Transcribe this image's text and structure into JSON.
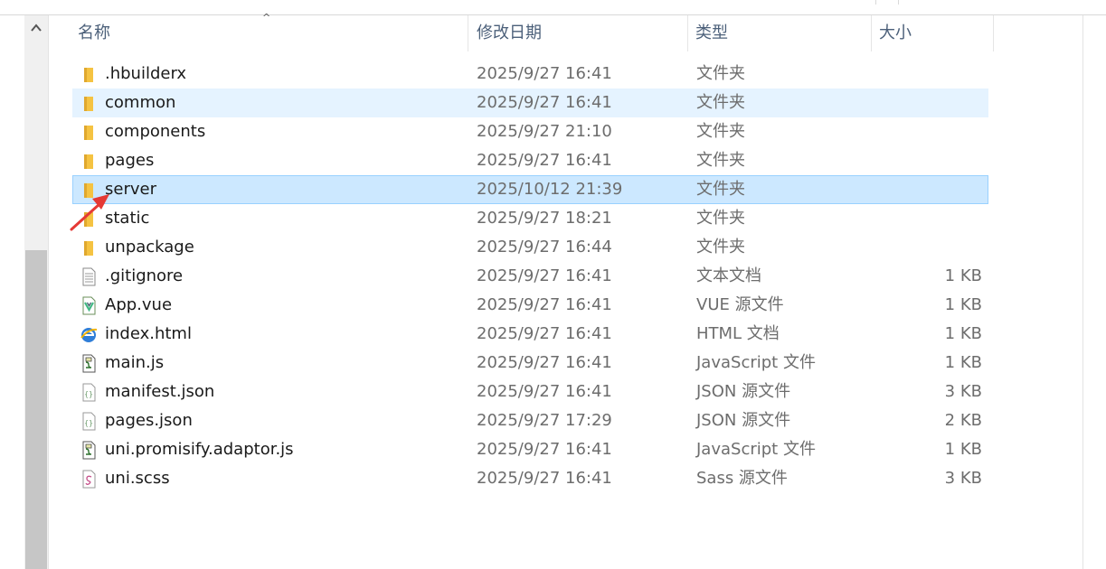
{
  "columns": {
    "name": "名称",
    "date": "修改日期",
    "type": "类型",
    "size": "大小"
  },
  "files": [
    {
      "name": ".hbuilderx",
      "date": "2025/9/27 16:41",
      "type": "文件夹",
      "size": "",
      "icon": "folder-icon",
      "state": "normal"
    },
    {
      "name": "common",
      "date": "2025/9/27 16:41",
      "type": "文件夹",
      "size": "",
      "icon": "folder-icon",
      "state": "hover"
    },
    {
      "name": "components",
      "date": "2025/9/27 21:10",
      "type": "文件夹",
      "size": "",
      "icon": "folder-icon",
      "state": "normal"
    },
    {
      "name": "pages",
      "date": "2025/9/27 16:41",
      "type": "文件夹",
      "size": "",
      "icon": "folder-icon",
      "state": "normal"
    },
    {
      "name": "server",
      "date": "2025/10/12 21:39",
      "type": "文件夹",
      "size": "",
      "icon": "folder-icon",
      "state": "selected"
    },
    {
      "name": "static",
      "date": "2025/9/27 18:21",
      "type": "文件夹",
      "size": "",
      "icon": "folder-icon",
      "state": "normal"
    },
    {
      "name": "unpackage",
      "date": "2025/9/27 16:44",
      "type": "文件夹",
      "size": "",
      "icon": "folder-icon",
      "state": "normal"
    },
    {
      "name": ".gitignore",
      "date": "2025/9/27 16:41",
      "type": "文本文档",
      "size": "1 KB",
      "icon": "text-file-icon",
      "state": "normal"
    },
    {
      "name": "App.vue",
      "date": "2025/9/27 16:41",
      "type": "VUE 源文件",
      "size": "1 KB",
      "icon": "vue-file-icon",
      "state": "normal"
    },
    {
      "name": "index.html",
      "date": "2025/9/27 16:41",
      "type": "HTML 文档",
      "size": "1 KB",
      "icon": "html-file-icon",
      "state": "normal"
    },
    {
      "name": "main.js",
      "date": "2025/9/27 16:41",
      "type": "JavaScript 文件",
      "size": "1 KB",
      "icon": "js-file-icon",
      "state": "normal"
    },
    {
      "name": "manifest.json",
      "date": "2025/9/27 16:41",
      "type": "JSON 源文件",
      "size": "3 KB",
      "icon": "json-file-icon",
      "state": "normal"
    },
    {
      "name": "pages.json",
      "date": "2025/9/27 17:29",
      "type": "JSON 源文件",
      "size": "2 KB",
      "icon": "json-file-icon",
      "state": "normal"
    },
    {
      "name": "uni.promisify.adaptor.js",
      "date": "2025/9/27 16:41",
      "type": "JavaScript 文件",
      "size": "1 KB",
      "icon": "js-file-icon",
      "state": "normal"
    },
    {
      "name": "uni.scss",
      "date": "2025/9/27 16:41",
      "type": "Sass 源文件",
      "size": "3 KB",
      "icon": "sass-file-icon",
      "state": "normal"
    }
  ],
  "colors": {
    "selected_bg": "#cce8ff",
    "selected_border": "#99d1ff",
    "hover_bg": "#e5f3ff",
    "folder": "#f5c342",
    "annotation_arrow": "#e53935"
  }
}
